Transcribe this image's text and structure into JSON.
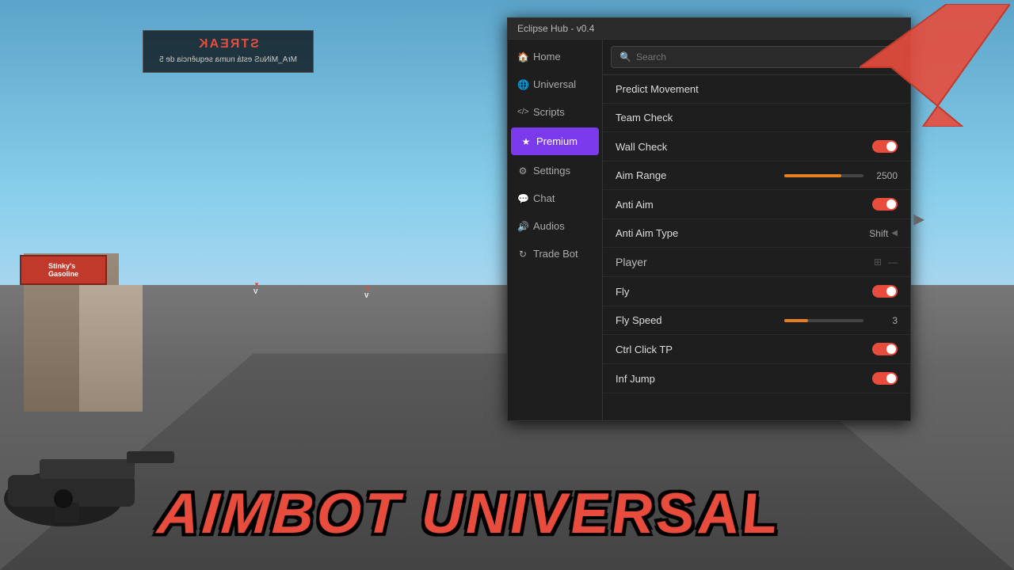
{
  "window": {
    "title": "Eclipse Hub - v0.4"
  },
  "sidebar": {
    "items": [
      {
        "id": "home",
        "icon": "🏠",
        "label": "Home"
      },
      {
        "id": "universal",
        "icon": "🌐",
        "label": "Universal"
      },
      {
        "id": "scripts",
        "icon": "<>",
        "label": "Scripts"
      },
      {
        "id": "premium",
        "icon": "★",
        "label": "Premium",
        "active": true
      },
      {
        "id": "settings",
        "icon": "⚙",
        "label": "Settings"
      },
      {
        "id": "chat",
        "icon": "💬",
        "label": "Chat"
      },
      {
        "id": "audios",
        "icon": "🔊",
        "label": "Audios"
      },
      {
        "id": "tradebot",
        "icon": "↻",
        "label": "Trade Bot"
      }
    ]
  },
  "search": {
    "placeholder": "Search"
  },
  "settings_rows": [
    {
      "id": "predict-movement",
      "label": "Predict Movement",
      "type": "none",
      "value": ""
    },
    {
      "id": "team-check",
      "label": "Team Check",
      "type": "none",
      "value": ""
    },
    {
      "id": "wall-check",
      "label": "Wall Check",
      "type": "toggle",
      "value": true
    },
    {
      "id": "aim-range",
      "label": "Aim Range",
      "type": "slider",
      "slider_pct": 72,
      "value": "2500"
    },
    {
      "id": "anti-aim",
      "label": "Anti Aim",
      "type": "toggle",
      "value": true
    },
    {
      "id": "anti-aim-type",
      "label": "Anti Aim Type",
      "type": "select",
      "value": "Shift"
    }
  ],
  "player_section": {
    "label": "Player"
  },
  "player_rows": [
    {
      "id": "fly",
      "label": "Fly",
      "type": "toggle",
      "value": true
    },
    {
      "id": "fly-speed",
      "label": "Fly Speed",
      "type": "slider",
      "slider_pct": 30,
      "value": "3"
    },
    {
      "id": "ctrl-click-tp",
      "label": "Ctrl Click TP",
      "type": "toggle",
      "value": true
    },
    {
      "id": "inf-jump",
      "label": "Inf Jump",
      "type": "toggle",
      "value": true
    }
  ],
  "streak": {
    "title": "STREAK",
    "subtitle": "MrA_MiNuS está numa sequência de 5"
  },
  "aimbot_text": "AIMBOT UNIVERSAL",
  "colors": {
    "accent": "#7c3aed",
    "toggle_on": "#e74c3c",
    "slider": "#e67e22"
  }
}
